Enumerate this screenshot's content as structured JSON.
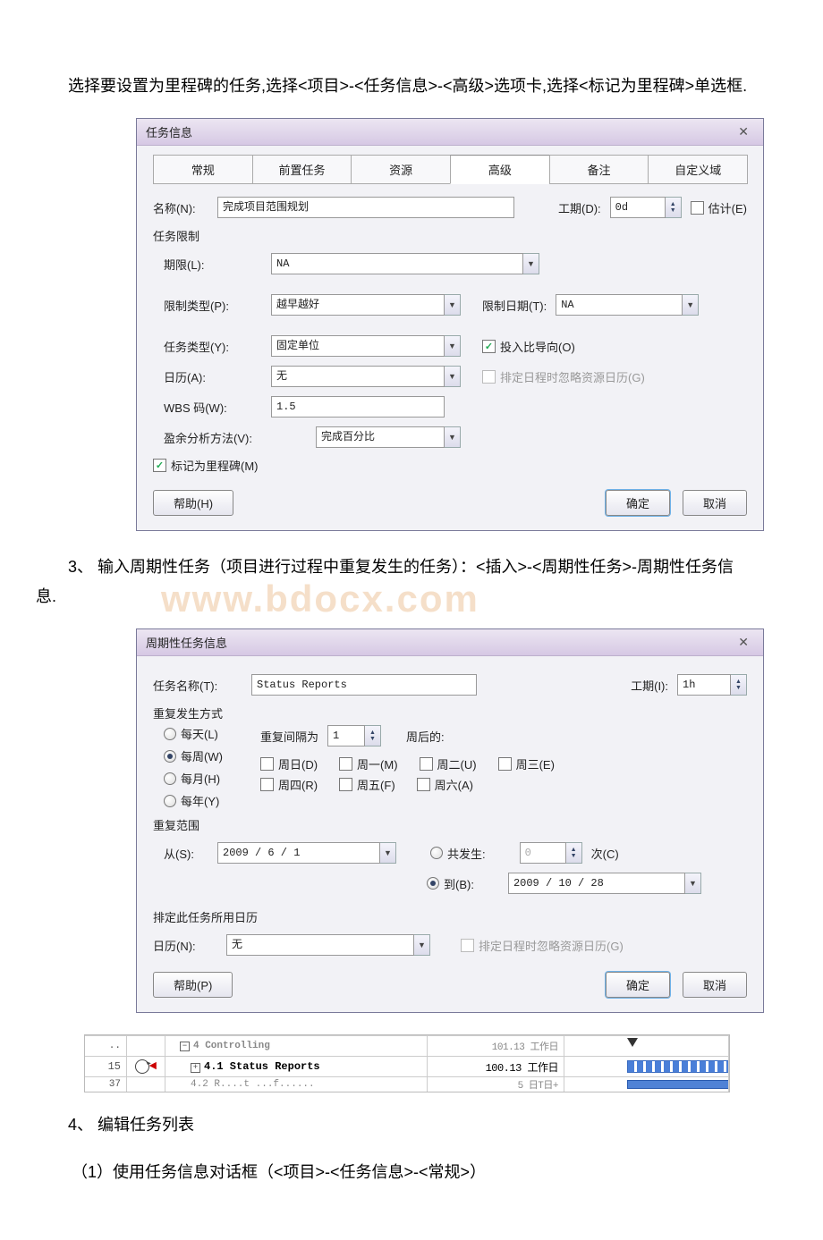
{
  "intro_para": "选择要设置为里程碑的任务,选择<项目>-<任务信息>-<高级>选项卡,选择<标记为里程碑>单选框.",
  "dialog1": {
    "title": "任务信息",
    "tabs": {
      "t1": "常规",
      "t2": "前置任务",
      "t3": "资源",
      "t4": "高级",
      "t5": "备注",
      "t6": "自定义域"
    },
    "name_label": "名称(N):",
    "name_value": "完成项目范围规划",
    "duration_label": "工期(D):",
    "duration_value": "0d",
    "estimate_label": "估计(E)",
    "section_constraint": "任务限制",
    "deadline_label": "期限(L):",
    "deadline_value": "NA",
    "constraint_type_label": "限制类型(P):",
    "constraint_type_value": "越早越好",
    "constraint_date_label": "限制日期(T):",
    "constraint_date_value": "NA",
    "task_type_label": "任务类型(Y):",
    "task_type_value": "固定单位",
    "effort_driven_label": "投入比导向(O)",
    "calendar_label": "日历(A):",
    "calendar_value": "无",
    "ignore_cal_label": "排定日程时忽略资源日历(G)",
    "wbs_label": "WBS 码(W):",
    "wbs_value": "1.5",
    "ev_label": "盈余分析方法(V):",
    "ev_value": "完成百分比",
    "milestone_label": "标记为里程碑(M)",
    "help": "帮助(H)",
    "ok": "确定",
    "cancel": "取消"
  },
  "para2": "3、 输入周期性任务（项目进行过程中重复发生的任务）：<插入>-<周期性任务>-周期性任务信息.",
  "watermark": "www.bdocx.com",
  "dialog2": {
    "title": "周期性任务信息",
    "name_label": "任务名称(T):",
    "name_value": "Status Reports",
    "duration_label": "工期(I):",
    "duration_value": "1h",
    "recur_section": "重复发生方式",
    "daily": "每天(L)",
    "weekly": "每周(W)",
    "monthly": "每月(H)",
    "yearly": "每年(Y)",
    "interval_prefix": "重复间隔为",
    "interval_value": "1",
    "interval_suffix": "周后的:",
    "sun": "周日(D)",
    "mon": "周一(M)",
    "tue": "周二(U)",
    "wed": "周三(E)",
    "thu": "周四(R)",
    "fri": "周五(F)",
    "sat": "周六(A)",
    "range_section": "重复范围",
    "from_label": "从(S):",
    "from_value": "2009 / 6 / 1",
    "occur_label": "共发生:",
    "occur_value": "0",
    "occur_suffix": "次(C)",
    "until_label": "到(B):",
    "until_value": "2009 / 10 / 28",
    "cal_section": "排定此任务所用日历",
    "calendar_label": "日历(N):",
    "calendar_value": "无",
    "ignore_cal_label": "排定日程时忽略资源日历(G)",
    "help": "帮助(P)",
    "ok": "确定",
    "cancel": "取消"
  },
  "gantt": {
    "row0_name": "4 Controlling",
    "row0_dur": "101.13 工作日",
    "row1_num": "15",
    "row1_name": "4.1 Status Reports",
    "row1_dur": "100.13 工作日",
    "row2_num": "37",
    "row2_name": "4.2 R....t ...f......",
    "row2_dur": "5 日T日+"
  },
  "para3": "4、 编辑任务列表",
  "para4": "（1）使用任务信息对话框（<项目>-<任务信息>-<常规>）"
}
